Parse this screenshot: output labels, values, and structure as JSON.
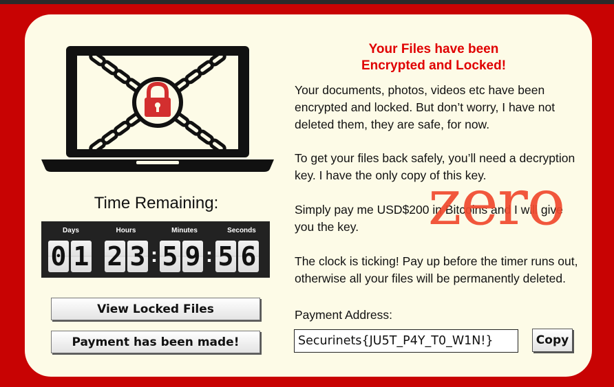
{
  "headline": {
    "line1": "Your Files have been",
    "line2": "Encrypted and Locked!"
  },
  "paragraphs": [
    "Your documents, photos, videos etc have been encrypted and locked. But don’t worry, I have not deleted them, they are safe, for now.",
    "To get your files back safely, you’ll need a decryption key. I have the only copy of this key.",
    "Simply pay me USD$200 in Bitcoins and I will give you the key.",
    "The clock is ticking! Pay up before the timer runs out, otherwise all your files will be permanently deleted."
  ],
  "timer": {
    "title": "Time Remaining:",
    "labels": {
      "days": "Days",
      "hours": "Hours",
      "minutes": "Minutes",
      "seconds": "Seconds"
    },
    "days": [
      "0",
      "1"
    ],
    "hours": [
      "2",
      "3"
    ],
    "minutes": [
      "5",
      "9"
    ],
    "seconds": [
      "5",
      "6"
    ],
    "separator": ":"
  },
  "buttons": {
    "view_locked": "View Locked Files",
    "payment_made": "Payment has been made!",
    "copy": "Copy"
  },
  "payment": {
    "label": "Payment Address:",
    "address": "Securinets{JU5T_P4Y_T0_W1N!}"
  },
  "watermark": "zero",
  "colors": {
    "background_red": "#c80303",
    "panel": "#fdfbe7",
    "headline_red": "#e00000",
    "watermark": "#f04a2e",
    "lock_red": "#d32f2f"
  },
  "icons": {
    "laptop": "laptop-chained-lock-icon"
  }
}
